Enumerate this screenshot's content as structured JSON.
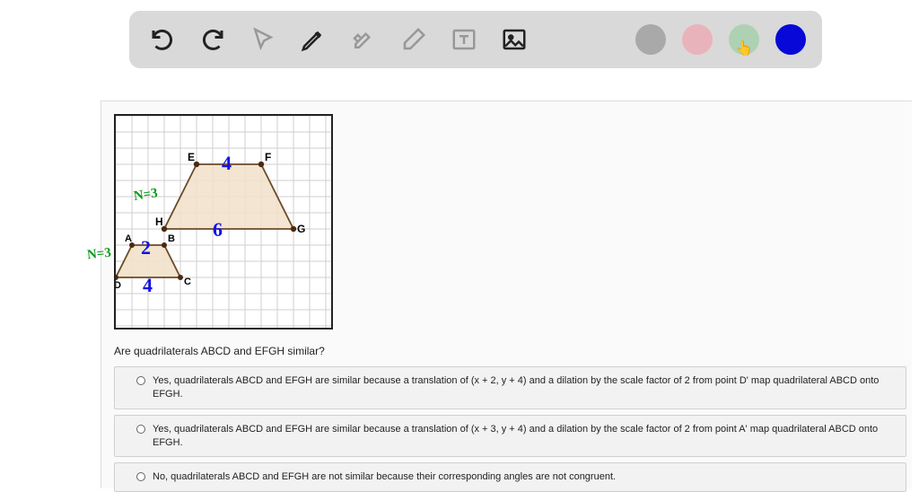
{
  "toolbar": {
    "items": [
      {
        "name": "undo-icon"
      },
      {
        "name": "redo-icon"
      },
      {
        "name": "pointer-icon"
      },
      {
        "name": "pencil-icon"
      },
      {
        "name": "tools-icon"
      },
      {
        "name": "eraser-icon"
      },
      {
        "name": "textbox-icon"
      },
      {
        "name": "image-icon"
      }
    ],
    "colors": [
      {
        "name": "color-grey",
        "hex": "#a9a9a9"
      },
      {
        "name": "color-pink",
        "hex": "#e9b3bb"
      },
      {
        "name": "color-green",
        "hex": "#aed1b3",
        "active_cursor": true
      },
      {
        "name": "color-blue",
        "hex": "#0808d8"
      }
    ]
  },
  "figure": {
    "large": {
      "points": {
        "E": "E",
        "F": "F",
        "G": "G",
        "H": "H"
      },
      "top_len": "4",
      "bottom_len": "6",
      "side_note": "N=3"
    },
    "small": {
      "points": {
        "A": "A",
        "B": "B",
        "C": "C",
        "D": "D"
      },
      "top_len": "2",
      "bottom_len": "4",
      "side_note": "N=3"
    }
  },
  "question": "Are quadrilaterals ABCD and EFGH similar?",
  "options": [
    "Yes, quadrilaterals ABCD and EFGH are similar because a translation of (x + 2, y + 4) and a dilation by the scale factor of 2 from point D' map quadrilateral ABCD onto EFGH.",
    "Yes, quadrilaterals ABCD and EFGH are similar because a translation of (x + 3, y + 4) and a dilation by the scale factor of 2 from point A' map quadrilateral ABCD onto EFGH.",
    "No, quadrilaterals ABCD and EFGH are not similar because their corresponding angles are not congruent."
  ]
}
